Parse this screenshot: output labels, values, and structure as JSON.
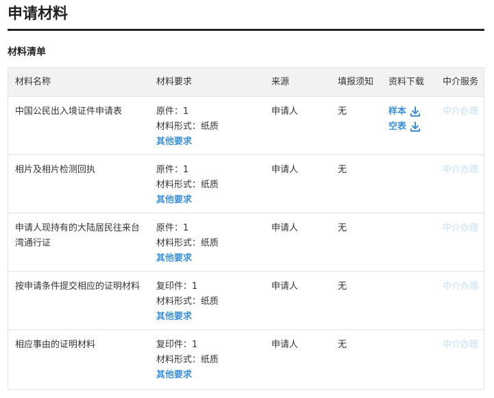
{
  "page": {
    "title": "申请材料",
    "section_title": "材料清单"
  },
  "table": {
    "headers": [
      "材料名称",
      "材料要求",
      "来源",
      "填报须知",
      "资料下载",
      "中介服务"
    ],
    "rows": [
      {
        "name": "中国公民出入境证件申请表",
        "req_count": "原件：1",
        "req_form": "材料形式：纸质",
        "req_more": "其他要求",
        "source": "申请人",
        "fill_note": "无",
        "downloads": [
          "样本",
          "空表"
        ],
        "service": "中介办理"
      },
      {
        "name": "相片及相片检测回执",
        "req_count": "原件：1",
        "req_form": "材料形式：纸质",
        "req_more": "其他要求",
        "source": "申请人",
        "fill_note": "无",
        "downloads": [],
        "service": "中介办理"
      },
      {
        "name_line1": "申请人现持有的大陆居民往来台",
        "name_line2": "湾通行证",
        "req_count": "原件：1",
        "req_form": "材料形式：纸质",
        "req_more": "其他要求",
        "source": "申请人",
        "fill_note": "无",
        "downloads": [],
        "service": "中介办理"
      },
      {
        "name": "按申请条件提交相应的证明材料",
        "req_count": "复印件：1",
        "req_form": "材料形式：纸质",
        "req_more": "其他要求",
        "source": "申请人",
        "fill_note": "无",
        "downloads": [],
        "service": "中介办理"
      },
      {
        "name": "相应事由的证明材料",
        "req_count": "复印件：1",
        "req_form": "材料形式：纸质",
        "req_more": "其他要求",
        "source": "申请人",
        "fill_note": "无",
        "downloads": [],
        "service": "中介办理"
      }
    ]
  },
  "icons": {
    "download": "download-icon"
  },
  "colors": {
    "link": "#3b8fd9",
    "disabled_link": "#d7e8f7",
    "header_bg": "#f2f2f2",
    "rule": "#222222"
  }
}
